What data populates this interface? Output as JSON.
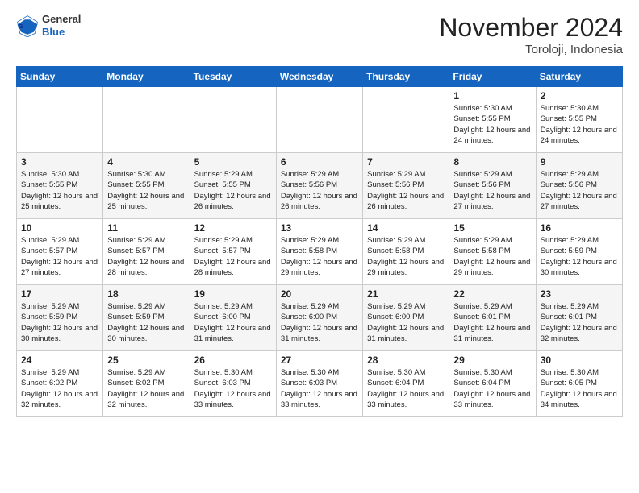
{
  "logo": {
    "general": "General",
    "blue": "Blue"
  },
  "header": {
    "month": "November 2024",
    "location": "Toroloji, Indonesia"
  },
  "weekdays": [
    "Sunday",
    "Monday",
    "Tuesday",
    "Wednesday",
    "Thursday",
    "Friday",
    "Saturday"
  ],
  "weeks": [
    [
      {
        "day": "",
        "sunrise": "",
        "sunset": "",
        "daylight": ""
      },
      {
        "day": "",
        "sunrise": "",
        "sunset": "",
        "daylight": ""
      },
      {
        "day": "",
        "sunrise": "",
        "sunset": "",
        "daylight": ""
      },
      {
        "day": "",
        "sunrise": "",
        "sunset": "",
        "daylight": ""
      },
      {
        "day": "",
        "sunrise": "",
        "sunset": "",
        "daylight": ""
      },
      {
        "day": "1",
        "sunrise": "Sunrise: 5:30 AM",
        "sunset": "Sunset: 5:55 PM",
        "daylight": "Daylight: 12 hours and 24 minutes."
      },
      {
        "day": "2",
        "sunrise": "Sunrise: 5:30 AM",
        "sunset": "Sunset: 5:55 PM",
        "daylight": "Daylight: 12 hours and 24 minutes."
      }
    ],
    [
      {
        "day": "3",
        "sunrise": "Sunrise: 5:30 AM",
        "sunset": "Sunset: 5:55 PM",
        "daylight": "Daylight: 12 hours and 25 minutes."
      },
      {
        "day": "4",
        "sunrise": "Sunrise: 5:30 AM",
        "sunset": "Sunset: 5:55 PM",
        "daylight": "Daylight: 12 hours and 25 minutes."
      },
      {
        "day": "5",
        "sunrise": "Sunrise: 5:29 AM",
        "sunset": "Sunset: 5:55 PM",
        "daylight": "Daylight: 12 hours and 26 minutes."
      },
      {
        "day": "6",
        "sunrise": "Sunrise: 5:29 AM",
        "sunset": "Sunset: 5:56 PM",
        "daylight": "Daylight: 12 hours and 26 minutes."
      },
      {
        "day": "7",
        "sunrise": "Sunrise: 5:29 AM",
        "sunset": "Sunset: 5:56 PM",
        "daylight": "Daylight: 12 hours and 26 minutes."
      },
      {
        "day": "8",
        "sunrise": "Sunrise: 5:29 AM",
        "sunset": "Sunset: 5:56 PM",
        "daylight": "Daylight: 12 hours and 27 minutes."
      },
      {
        "day": "9",
        "sunrise": "Sunrise: 5:29 AM",
        "sunset": "Sunset: 5:56 PM",
        "daylight": "Daylight: 12 hours and 27 minutes."
      }
    ],
    [
      {
        "day": "10",
        "sunrise": "Sunrise: 5:29 AM",
        "sunset": "Sunset: 5:57 PM",
        "daylight": "Daylight: 12 hours and 27 minutes."
      },
      {
        "day": "11",
        "sunrise": "Sunrise: 5:29 AM",
        "sunset": "Sunset: 5:57 PM",
        "daylight": "Daylight: 12 hours and 28 minutes."
      },
      {
        "day": "12",
        "sunrise": "Sunrise: 5:29 AM",
        "sunset": "Sunset: 5:57 PM",
        "daylight": "Daylight: 12 hours and 28 minutes."
      },
      {
        "day": "13",
        "sunrise": "Sunrise: 5:29 AM",
        "sunset": "Sunset: 5:58 PM",
        "daylight": "Daylight: 12 hours and 29 minutes."
      },
      {
        "day": "14",
        "sunrise": "Sunrise: 5:29 AM",
        "sunset": "Sunset: 5:58 PM",
        "daylight": "Daylight: 12 hours and 29 minutes."
      },
      {
        "day": "15",
        "sunrise": "Sunrise: 5:29 AM",
        "sunset": "Sunset: 5:58 PM",
        "daylight": "Daylight: 12 hours and 29 minutes."
      },
      {
        "day": "16",
        "sunrise": "Sunrise: 5:29 AM",
        "sunset": "Sunset: 5:59 PM",
        "daylight": "Daylight: 12 hours and 30 minutes."
      }
    ],
    [
      {
        "day": "17",
        "sunrise": "Sunrise: 5:29 AM",
        "sunset": "Sunset: 5:59 PM",
        "daylight": "Daylight: 12 hours and 30 minutes."
      },
      {
        "day": "18",
        "sunrise": "Sunrise: 5:29 AM",
        "sunset": "Sunset: 5:59 PM",
        "daylight": "Daylight: 12 hours and 30 minutes."
      },
      {
        "day": "19",
        "sunrise": "Sunrise: 5:29 AM",
        "sunset": "Sunset: 6:00 PM",
        "daylight": "Daylight: 12 hours and 31 minutes."
      },
      {
        "day": "20",
        "sunrise": "Sunrise: 5:29 AM",
        "sunset": "Sunset: 6:00 PM",
        "daylight": "Daylight: 12 hours and 31 minutes."
      },
      {
        "day": "21",
        "sunrise": "Sunrise: 5:29 AM",
        "sunset": "Sunset: 6:00 PM",
        "daylight": "Daylight: 12 hours and 31 minutes."
      },
      {
        "day": "22",
        "sunrise": "Sunrise: 5:29 AM",
        "sunset": "Sunset: 6:01 PM",
        "daylight": "Daylight: 12 hours and 31 minutes."
      },
      {
        "day": "23",
        "sunrise": "Sunrise: 5:29 AM",
        "sunset": "Sunset: 6:01 PM",
        "daylight": "Daylight: 12 hours and 32 minutes."
      }
    ],
    [
      {
        "day": "24",
        "sunrise": "Sunrise: 5:29 AM",
        "sunset": "Sunset: 6:02 PM",
        "daylight": "Daylight: 12 hours and 32 minutes."
      },
      {
        "day": "25",
        "sunrise": "Sunrise: 5:29 AM",
        "sunset": "Sunset: 6:02 PM",
        "daylight": "Daylight: 12 hours and 32 minutes."
      },
      {
        "day": "26",
        "sunrise": "Sunrise: 5:30 AM",
        "sunset": "Sunset: 6:03 PM",
        "daylight": "Daylight: 12 hours and 33 minutes."
      },
      {
        "day": "27",
        "sunrise": "Sunrise: 5:30 AM",
        "sunset": "Sunset: 6:03 PM",
        "daylight": "Daylight: 12 hours and 33 minutes."
      },
      {
        "day": "28",
        "sunrise": "Sunrise: 5:30 AM",
        "sunset": "Sunset: 6:04 PM",
        "daylight": "Daylight: 12 hours and 33 minutes."
      },
      {
        "day": "29",
        "sunrise": "Sunrise: 5:30 AM",
        "sunset": "Sunset: 6:04 PM",
        "daylight": "Daylight: 12 hours and 33 minutes."
      },
      {
        "day": "30",
        "sunrise": "Sunrise: 5:30 AM",
        "sunset": "Sunset: 6:05 PM",
        "daylight": "Daylight: 12 hours and 34 minutes."
      }
    ]
  ]
}
